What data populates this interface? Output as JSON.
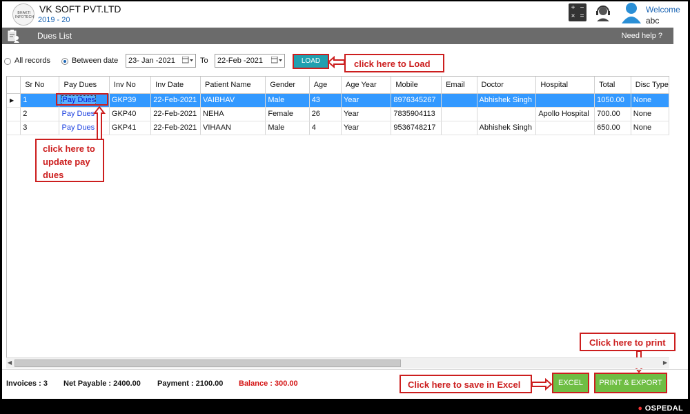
{
  "header": {
    "logo_text": "BHAKTI INFOTECH",
    "company": "VK SOFT PVT.LTD",
    "year": "2019 - 20",
    "welcome": "Welcome",
    "username": "abc",
    "icons": [
      "calculator-icon",
      "support-headset-icon",
      "user-icon"
    ]
  },
  "titlebar": {
    "title": "Dues List",
    "help": "Need help ?"
  },
  "filters": {
    "all_records": "All records",
    "between_date": "Between date",
    "selected": "Between date",
    "from_date": "23- Jan -2021",
    "to_label": "To",
    "to_date": "22-Feb -2021",
    "load": "LOAD"
  },
  "annotations": {
    "load": "click here to Load",
    "pay_dues_1": "click here to",
    "pay_dues_2": "update pay",
    "pay_dues_3": "dues",
    "print": "Click here to print",
    "excel": "Click here to save in Excel"
  },
  "grid": {
    "columns": [
      "Sr No",
      "Pay Dues",
      "Inv No",
      "Inv Date",
      "Patient Name",
      "Gender",
      "Age",
      "Age Year",
      "Mobile",
      "Email",
      "Doctor",
      "Hospital",
      "Total",
      "Disc Type"
    ],
    "rows": [
      [
        "1",
        "Pay Dues",
        "GKP39",
        "22-Feb-2021",
        "VAIBHAV",
        "Male",
        "43",
        "Year",
        "8976345267",
        "",
        "Abhishek Singh",
        "",
        "1050.00",
        "None"
      ],
      [
        "2",
        "Pay Dues",
        "GKP40",
        "22-Feb-2021",
        "NEHA",
        "Female",
        "26",
        "Year",
        "7835904113",
        "",
        "",
        "Apollo Hospital",
        "700.00",
        "None"
      ],
      [
        "3",
        "Pay Dues",
        "GKP41",
        "22-Feb-2021",
        "VIHAAN",
        "Male",
        "4",
        "Year",
        "9536748217",
        "",
        "Abhishek Singh",
        "",
        "650.00",
        "None"
      ]
    ],
    "selected_row": 0
  },
  "summary": {
    "invoices_label": "Invoices :",
    "invoices": "3",
    "net_label": "Net Payable :",
    "net": "2400.00",
    "payment_label": "Payment :",
    "payment": "2100.00",
    "balance_label": "Balance :",
    "balance": "300.00"
  },
  "buttons": {
    "excel": "EXCEL",
    "print": "PRINT & EXPORT"
  },
  "brand": "OSPEDAL",
  "colors": {
    "accent": "#1a64b3",
    "selection": "#3399ff",
    "load": "#20a0b0",
    "green": "#6fbe44",
    "annotation": "#cc1e1e",
    "balance": "#d41414"
  }
}
